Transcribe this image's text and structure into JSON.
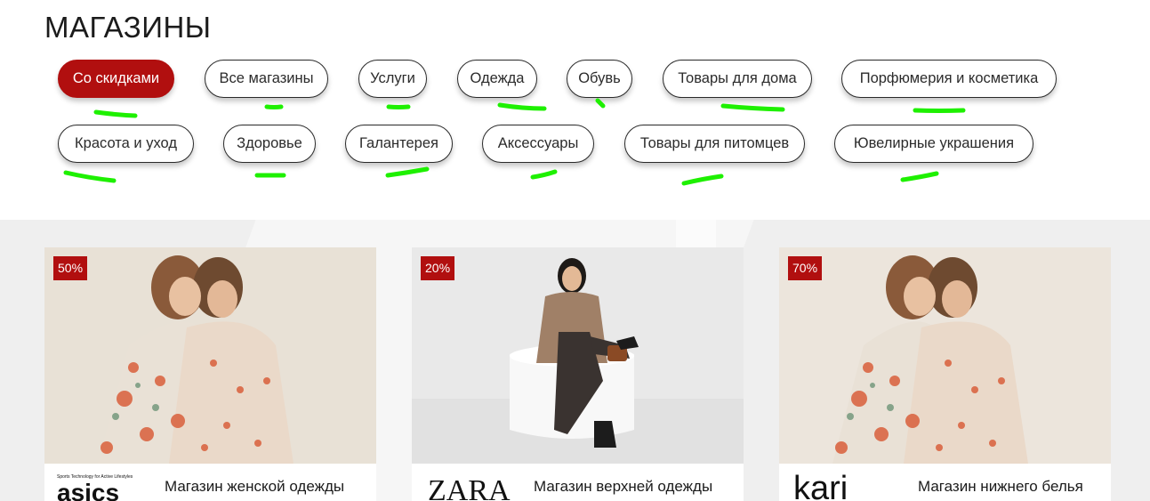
{
  "page": {
    "title": "МАГАЗИНЫ"
  },
  "filters": [
    "Со скидками",
    "Все магазины",
    "Услуги",
    "Одежда",
    "Обувь",
    "Товары для дома",
    "Порфюмерия и косметика",
    "Красота и уход",
    "Здоровье",
    "Галантерея",
    "Аксессуары",
    "Товары для питомцев",
    "Ювелирные украшения"
  ],
  "active_filter": "Со скидками",
  "colors": {
    "accent": "#b10f0f",
    "marker": "#1ef000",
    "band": "#efefef"
  },
  "stores": [
    {
      "discount": "50%",
      "brand": "asics",
      "tagline": "Sports Technology for Active Lifestyles",
      "description": "Магазин женской одежды"
    },
    {
      "discount": "20%",
      "brand": "ZARA",
      "description": "Магазин верхней одежды"
    },
    {
      "discount": "70%",
      "brand": "kari",
      "description": "Магазин нижнего белья"
    }
  ]
}
